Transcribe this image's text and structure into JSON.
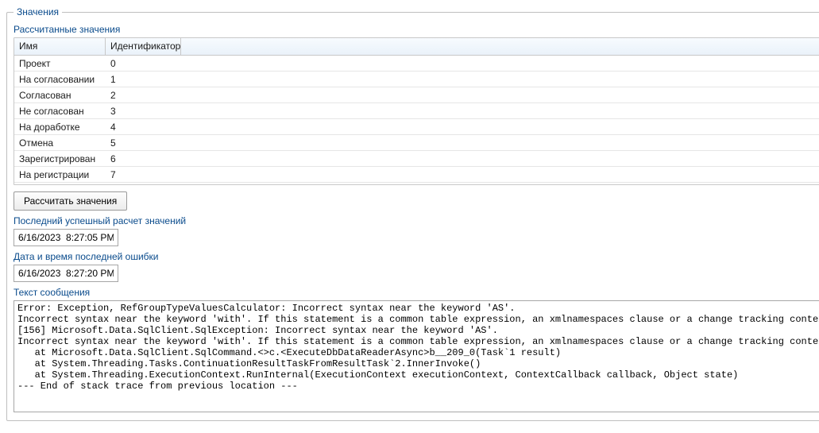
{
  "groupbox": {
    "title": "Значения"
  },
  "calcValues": {
    "label": "Рассчитанные значения",
    "columns": {
      "name": "Имя",
      "id": "Идентификатор"
    },
    "rows": [
      {
        "name": "Проект",
        "id": "0"
      },
      {
        "name": "На согласовании",
        "id": "1"
      },
      {
        "name": "Согласован",
        "id": "2"
      },
      {
        "name": "Не согласован",
        "id": "3"
      },
      {
        "name": "На доработке",
        "id": "4"
      },
      {
        "name": "Отмена",
        "id": "5"
      },
      {
        "name": "Зарегистрирован",
        "id": "6"
      },
      {
        "name": "На регистрации",
        "id": "7"
      }
    ]
  },
  "calculateButton": {
    "label": "Рассчитать значения"
  },
  "lastSuccess": {
    "label": "Последний успешный расчет значений",
    "value": "6/16/2023  8:27:05 PM"
  },
  "lastError": {
    "label": "Дата и время последней ошибки",
    "value": "6/16/2023  8:27:20 PM"
  },
  "message": {
    "label": "Текст сообщения",
    "text": "Error: Exception, RefGroupTypeValuesCalculator: Incorrect syntax near the keyword 'AS'.\nIncorrect syntax near the keyword 'with'. If this statement is a common table expression, an xmlnamespaces clause or a change tracking context clause, the previous statement must be terminated with a semicolon.\n[156] Microsoft.Data.SqlClient.SqlException: Incorrect syntax near the keyword 'AS'.\nIncorrect syntax near the keyword 'with'. If this statement is a common table expression, an xmlnamespaces clause or a change tracking context clause, the previous statement must be terminated with a semicolon.\n   at Microsoft.Data.SqlClient.SqlCommand.<>c.<ExecuteDbDataReaderAsync>b__209_0(Task`1 result)\n   at System.Threading.Tasks.ContinuationResultTaskFromResultTask`2.InnerInvoke()\n   at System.Threading.ExecutionContext.RunInternal(ExecutionContext executionContext, ContextCallback callback, Object state)\n--- End of stack trace from previous location ---"
  }
}
